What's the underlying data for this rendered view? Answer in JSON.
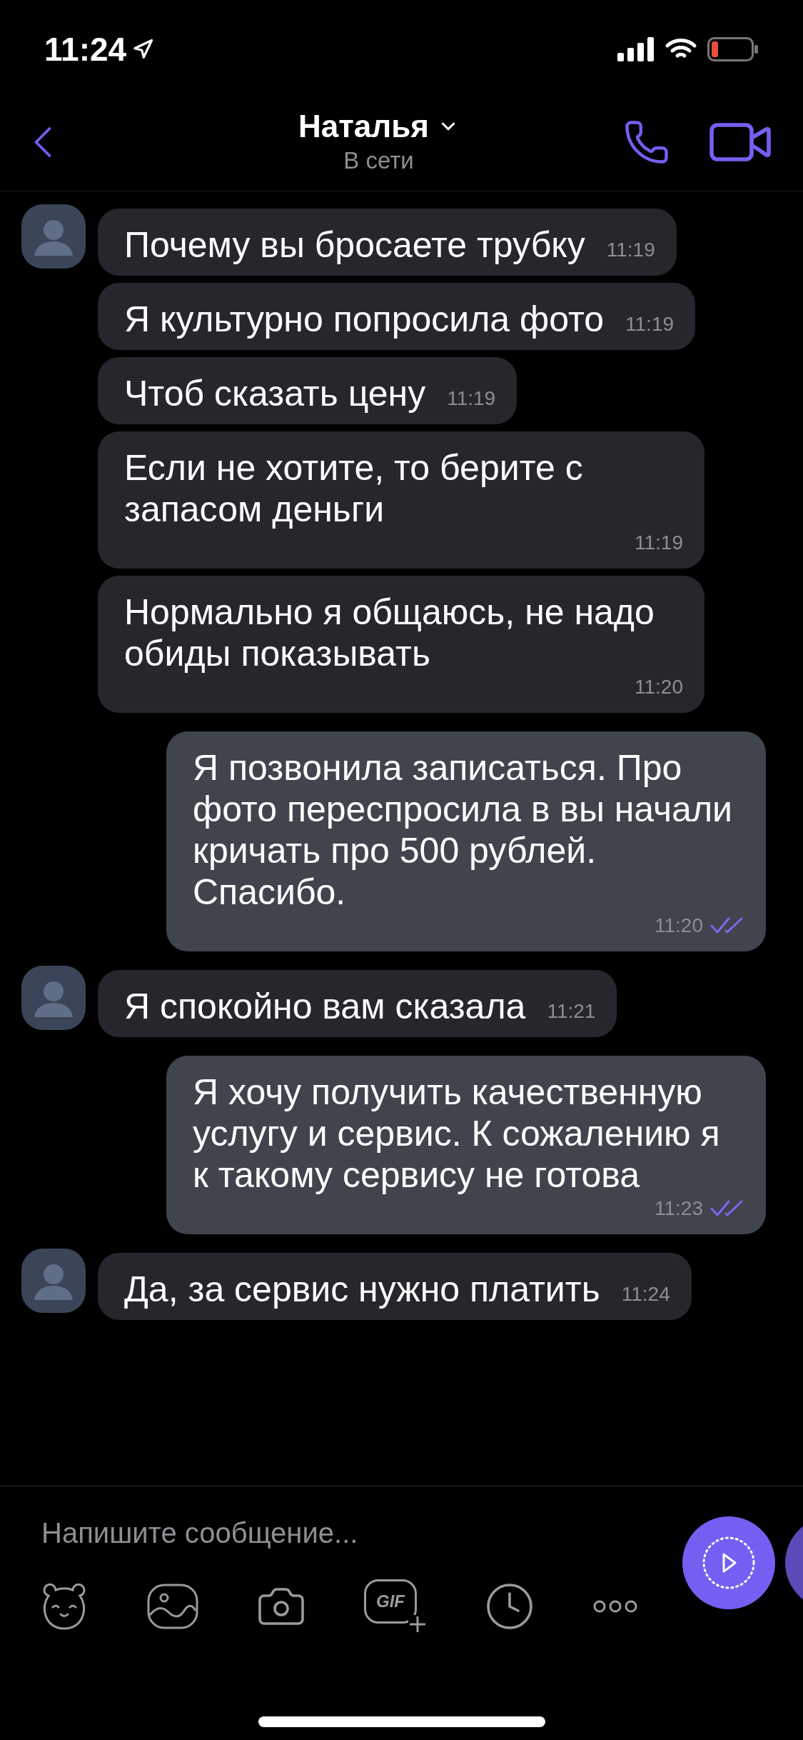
{
  "status_bar": {
    "time": "11:24"
  },
  "header": {
    "name": "Наталья",
    "status": "В сети"
  },
  "messages": [
    {
      "kind": "incoming",
      "avatar": true,
      "text": "Почему вы бросаете трубку",
      "time": "11:19"
    },
    {
      "kind": "incoming",
      "avatar": false,
      "text": "Я культурно попросила фото",
      "time": "11:19"
    },
    {
      "kind": "incoming",
      "avatar": false,
      "text": "Чтоб сказать цену",
      "time": "11:19"
    },
    {
      "kind": "incoming",
      "avatar": false,
      "text": "Если не хотите, то берите с запасом деньги",
      "time": "11:19"
    },
    {
      "kind": "incoming",
      "avatar": false,
      "text": "Нормально я общаюсь, не надо обиды показывать",
      "time": "11:20"
    },
    {
      "kind": "outgoing",
      "text": "Я позвонила записаться. Про фото переспросила в вы начали кричать про 500 рублей. Спасибо.",
      "time": "11:20",
      "read": true
    },
    {
      "kind": "incoming",
      "avatar": true,
      "text": "Я спокойно вам сказала",
      "time": "11:21"
    },
    {
      "kind": "outgoing",
      "text": "Я хочу получить качественную услугу и сервис. К сожалению я к такому сервису не готова",
      "time": "11:23",
      "read": true
    },
    {
      "kind": "incoming",
      "avatar": true,
      "text": "Да, за сервис нужно платить",
      "time": "11:24"
    }
  ],
  "composer": {
    "placeholder": "Напишите сообщение...",
    "gif_label": "GIF"
  }
}
